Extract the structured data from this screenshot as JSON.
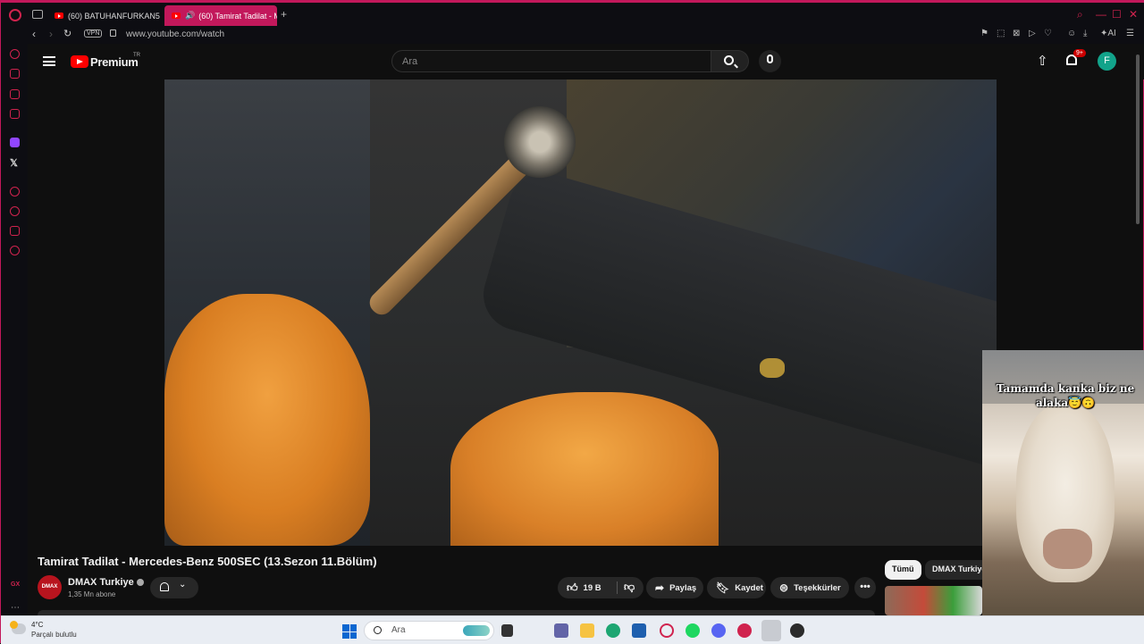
{
  "browser": {
    "tabs": [
      {
        "label": "(60) BATUHANFURKAN5"
      },
      {
        "label": "(60) Tamirat Tadilat - M"
      }
    ],
    "vpn_label": "VPN",
    "url": "www.youtube.com/watch",
    "ai_label": "AI"
  },
  "youtube": {
    "brand": "Premium",
    "region": "TR",
    "search_placeholder": "Ara",
    "notifications_badge": "9+",
    "user_initial": "F"
  },
  "video": {
    "title": "Tamirat Tadilat - Mercedes-Benz 500SEC (13.Sezon 11.Bölüm)",
    "channel_name": "DMAX Turkiye",
    "channel_logo_text": "DMAX",
    "subscribers": "1,35 Mn abone",
    "likes": "19 B",
    "share_label": "Paylaş",
    "save_label": "Kaydet",
    "thanks_label": "Teşekkürler",
    "more_label": "•••"
  },
  "related": {
    "chips": [
      "Tümü",
      "DMAX Turkiye"
    ]
  },
  "pip": {
    "caption": "Tamamda kanka biz ne alaka😇🙃"
  },
  "taskbar": {
    "temperature": "4°C",
    "condition": "Parçalı bulutlu",
    "search_placeholder": "Ara"
  },
  "colors": {
    "opera_accent": "#c2185b",
    "youtube_red": "#ff0000",
    "avatar_teal": "#12a38a"
  }
}
